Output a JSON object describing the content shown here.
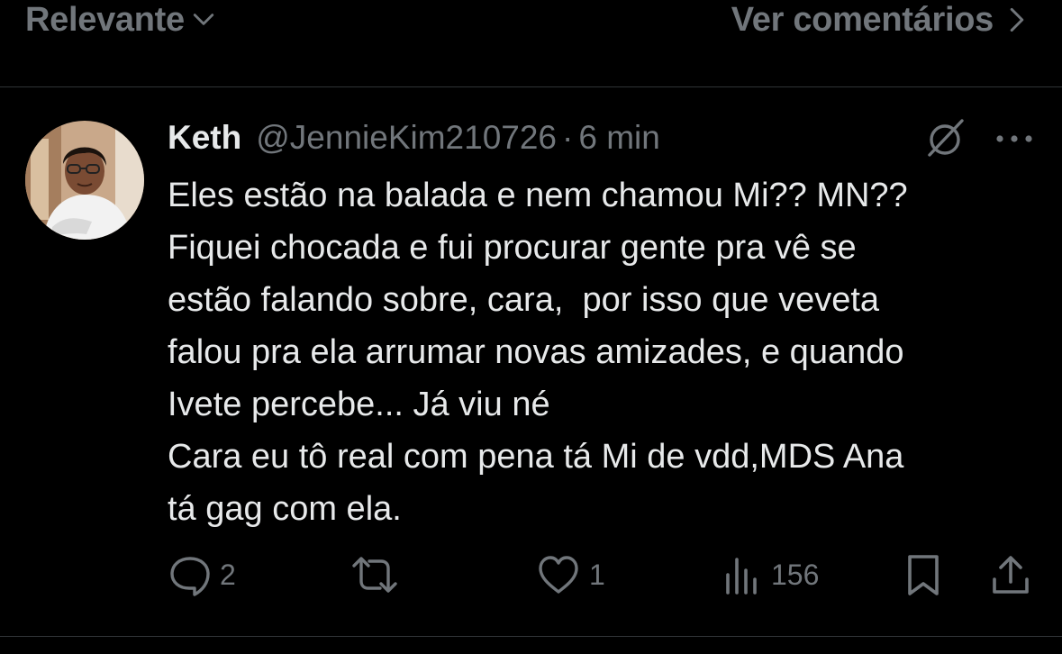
{
  "header": {
    "sort_label": "Relevante",
    "view_comments_label": "Ver comentários"
  },
  "tweet": {
    "display_name": "Keth",
    "handle": "@JennieKim210726",
    "separator": "·",
    "time": "6 min",
    "text": "Eles estão na balada e nem chamou Mi?? MN??\nFiquei chocada e fui procurar gente pra vê se\nestão falando sobre, cara,  por isso que veveta\nfalou pra ela arrumar novas amizades, e quando\nIvete percebe... Já viu né\nCara eu tô real com pena tá Mi de vdd,MDS Ana\ntá gag com ela.",
    "avatar_icon": "profile-photo"
  },
  "actions": {
    "reply_count": "2",
    "repost_count": "",
    "like_count": "1",
    "views_count": "156"
  },
  "colors": {
    "background": "#000000",
    "text_primary": "#e7e9ea",
    "text_secondary": "#71767b",
    "divider": "#2f3336"
  }
}
